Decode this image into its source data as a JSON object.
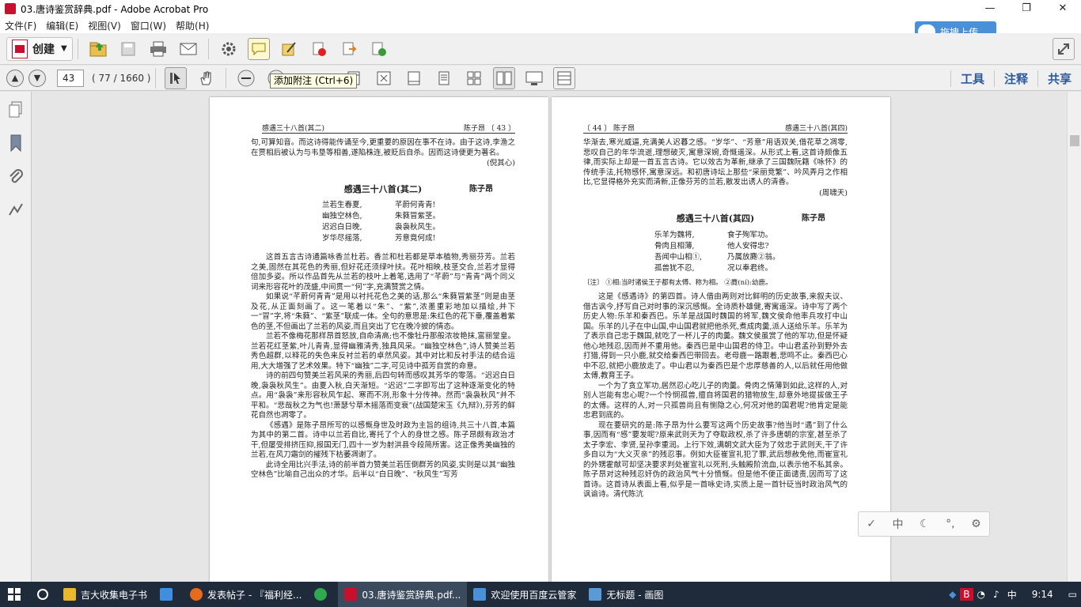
{
  "window": {
    "title": "03.唐诗鉴赏辞典.pdf - Adobe Acrobat Pro",
    "minimize": "—",
    "restore": "❐",
    "close": "✕"
  },
  "menu": [
    "文件(F)",
    "编辑(E)",
    "视图(V)",
    "窗口(W)",
    "帮助(H)"
  ],
  "baidu_upload": {
    "label": "拖拽上传"
  },
  "toolbar": {
    "create_label": "创建",
    "icons": [
      "open-folder-icon",
      "save-icon",
      "print-icon",
      "email-icon",
      "gear-icon",
      "comment-icon",
      "sign-icon",
      "redact-icon",
      "export-icon",
      "combine-icon"
    ]
  },
  "nav": {
    "page_value": "43",
    "page_count": "( 77 / 1660 )"
  },
  "tooltip": "添加附注 (Ctrl+6)",
  "right_tabs": [
    "工具",
    "注释",
    "共享"
  ],
  "left_page": {
    "head_left": "感遇三十八首(其二)",
    "head_right": "陈子昂 〔 43 〕",
    "intro_para": "句,可算知音。而这诗得能传诵至今,更重要的原因在事不在诗。由于这诗,李渔之在贾相后被认为与韦垦等相善,遂陷株连,被贬后自杀。因而这诗便更为著名。",
    "intro_sign": "(倪其心)",
    "poem_title": "感遇三十八首(其二)",
    "poem_author": "陈子昂",
    "poem": [
      [
        "兰若生春夏,",
        "芊蔚何青青!"
      ],
      [
        "幽独空林色,",
        "朱蕤冒紫茎。"
      ],
      [
        "迟迟白日晚,",
        "袅袅秋风生。"
      ],
      [
        "岁华尽摇落,",
        "芳意竟何成!"
      ]
    ],
    "paras": [
      "这首五言古诗通篇咏香兰杜若。香兰和杜若都是草本植物,秀丽芬芳。兰若之美,固然在其花色的秀丽,但好花还须绿叶扶。花叶相映,枝茎交合,兰若才显得倍加多姿。所以作品首先从兰若的枝叶上着笔,选用了“芊蔚”与“青青”两个同义词来形容花叶的茂盛,中间贯一“何”字,充满赞赏之情。",
      "如果说“芊蔚何青青”是用以衬托花色之美的话,那么“朱蕤冒紫茎”则是由茎及花,从正面刻画了。这一笔着以“朱”、“紫”,浓墨重彩地加以描绘,并下一“冒”字,将“朱蕤”、“紫茎”联成一体。全句的意思是:朱红色的花下垂,覆盖着紫色的茎,不但画出了兰若的风姿,而且突出了它在晚冷披的情态。",
      "兰若不像梅花那样昂首怒放,自命清高;也不像牡丹那般浓妆艳抹,富丽堂皇。兰若花红茎紫,叶儿青青,显得幽雅清秀,独具风采。“幽独空林色”,诗人赞美兰若秀色超群,以释花的失色来反衬兰若的卓然风姿。其中对比和反衬手法的结合运用,大大增强了艺术效果。特下“幽独”二字,可见诗中孤芳自赏的命意。",
      "诗的前四句赞美兰若风采的秀丽,后四句转而感叹其芳华的零落。“迟迟白日晚,袅袅秋风生”。由夏入秋,白天渐短。“迟迟”二字即写出了这种逐渐变化的特点。用“袅袅”来形容秋风乍起、寒而不冽,形象十分传神。然而“袅袅秋风”并不平和。“悲哉秋之为气也!萧瑟兮草木摇落而变衰”(战国楚宋玉《九辩》),芬芳的鲜花自然也凋零了。",
      "《感遇》是陈子昂所写的以感慨身世及时政为主旨的组诗,共三十八首,本篇为其中的第二首。诗中以兰若自比,寄托了个人的身世之感。陈子昂颇有政治才干,但屡受排挤压抑,报国无门,四十一岁为射洪县令段简所害。这正像秀美幽独的兰若,在风刀霜剑的摧残下枯萎凋谢了。",
      "此诗全用比兴手法,诗的前半首力赞美兰若压倒群芳的风姿,实则是以其“幽独空林色”比喻自己出众的才华。后半以“白日晚”、“秋风生”写芳"
    ]
  },
  "right_page": {
    "head_left": "〔 44 〕 陈子昂",
    "head_right": "感遇三十八首(其四)",
    "intro_para": "华渐去,寒光威逼,充满美人迟暮之感。“岁华”、“芳意”用语双关,借花草之凋零,悲叹自己的年华流逝,理想破灭,寓意深婉,奇慨遥深。从形式上看,这首诗颇像五律,而实际上却是一首五言古诗。它以效古为革新,继承了三国魏阮籍《咏怀》的传统手法,托物感怀,寓意深远。和初唐诗坛上那些“采丽竞繁”、吟风弄月之作相比,它显得格外充实而清新,正像芬芳的兰若,散发出诱人的清香。",
    "intro_sign": "(周啸天)",
    "poem_title": "感遇三十八首(其四)",
    "poem_author": "陈子昂",
    "poem": [
      [
        "乐羊为魏将,",
        "食子殉军功。"
      ],
      [
        "骨肉且相薄,",
        "他人安得忠?"
      ],
      [
        "吾闻中山相①,",
        "乃属放麑②翁。"
      ],
      [
        "孤兽犹不忍,",
        "况以奉君终。"
      ]
    ],
    "notes_label": "〔注〕",
    "notes_text": "①相:当时诸侯王子都有太傅、称为相。 ②麑(ní):幼鹿。",
    "paras": [
      "这是《感遇诗》的第四首。诗人借由两则对比鲜明的历史故事,来叙夫议、借古讽今,抒写自己对时事的深沉感慨。全诗质朴雄健,寄寓遥深。诗中写了两个历史人物:乐羊和秦西巴。乐羊是战国时魏国的将军,魏文侯命他率兵攻打中山国。乐羊的儿子在中山国,中山国君就把他杀死,煮成肉羹,派人送给乐羊。乐羊为了表示自己忠于魏国,就吃了一杯儿子的肉羹。魏文侯虽赏了他的军功,但是怀疑他心地残忍,因而并不重用他。秦西巴是中山国君的侍卫。中山君孟孙到野外去打猎,得到一只小鹿,就交给秦西巴带回去。老母鹿一路跟着,悲鸣不止。秦西巴心中不忍,就把小鹿放走了。中山君以为秦西巴是个忠厚慈善的人,以后就任用他做太傅,教育王子。",
      "一个为了贪立军功,居然忍心吃儿子的肉羹。骨肉之情薄到如此,这样的人,对别人岂能有忠心呢?一个怜悯孤兽,擅自将国君的猎物放生,却意外地提拔做王子的太傅。这样的人,对一只孤兽尚且有恻隐之心,何况对他的国君呢?他肯定是能忠君到底的。",
      "现在要研究的是:陈子昂为什么要写这两个历史故事?他当时“遇”到了什么事,因而有“感”要发呢?原来武则天为了夺取政权,杀了许多唐朝的宗室,甚至杀了太子李宏、李贤,呈孙李重润。上行下效,满朝文武大臣为了效忠于武则天,干了许多自以为“大义灭亲”的残忍事。例如大臣崔宣礼犯了罪,武后想赦免他,而崔宣礼的外甥霍献可却坚决要求判处崔宣礼以死刑,头触殿阶流血,以表示他不私其亲。陈子昂对这种残忍奸伪的政治风气十分愤慨。但是他不便正面谴责,因而写了这首诗。这首诗从表面上看,似乎是一首咏史诗,实质上是一首针砭当时政治风气的讽谕诗。清代陈沆"
    ]
  },
  "floating_bar": [
    "✓",
    "中",
    "☾",
    "°,",
    "⚙"
  ],
  "taskbar": {
    "items": [
      {
        "label": "吉大收集电子书",
        "color": "#e8b830"
      },
      {
        "label": "",
        "color": "#3f8ee0"
      },
      {
        "label": "发表帖子 - 『福利经...",
        "color": "#e66b1a"
      },
      {
        "label": "",
        "color": "#2fa84f"
      },
      {
        "label": "03.唐诗鉴赏辞典.pdf...",
        "color": "#c8102e"
      },
      {
        "label": "欢迎使用百度云管家",
        "color": "#4a90d9"
      },
      {
        "label": "无标题 - 画图",
        "color": "#5b9bd5"
      }
    ],
    "ime": "中",
    "time": "9:14"
  }
}
